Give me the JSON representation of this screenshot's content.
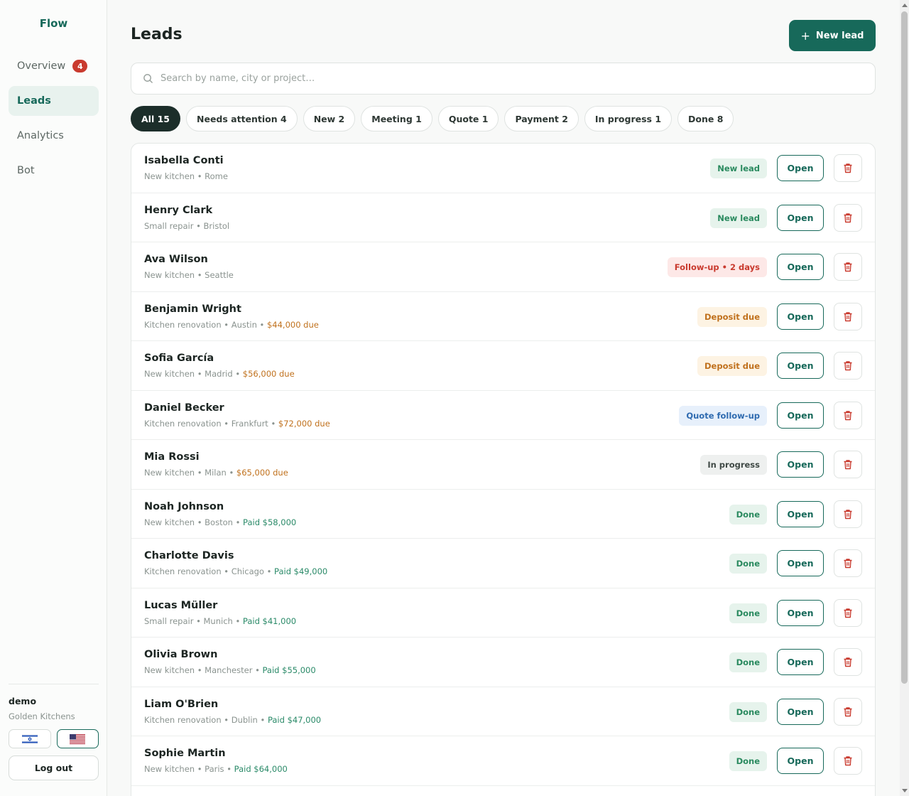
{
  "sidebar": {
    "brand": "Flow",
    "items": [
      {
        "label": "Overview",
        "badge": "4",
        "active": false
      },
      {
        "label": "Leads",
        "active": true
      },
      {
        "label": "Analytics",
        "active": false
      },
      {
        "label": "Bot",
        "active": false
      }
    ],
    "user": {
      "name": "demo",
      "org": "Golden Kitchens"
    },
    "languages": [
      {
        "flag": "israel-flag-icon",
        "active": false
      },
      {
        "flag": "us-flag-icon",
        "active": true
      }
    ],
    "logout_label": "Log out"
  },
  "header": {
    "title": "Leads",
    "new_lead_label": "New lead",
    "search_placeholder": "Search by name, city or project…"
  },
  "filters": [
    {
      "label": "All 15",
      "active": true
    },
    {
      "label": "Needs attention 4"
    },
    {
      "label": "New 2"
    },
    {
      "label": "Meeting 1"
    },
    {
      "label": "Quote 1"
    },
    {
      "label": "Payment 2"
    },
    {
      "label": "In progress 1"
    },
    {
      "label": "Done 8"
    }
  ],
  "open_label": "Open",
  "leads": [
    {
      "name": "Isabella Conti",
      "meta": "New kitchen • Rome",
      "amount": "",
      "amount_type": "",
      "status": "New lead",
      "status_type": "new"
    },
    {
      "name": "Henry Clark",
      "meta": "Small repair • Bristol",
      "amount": "",
      "amount_type": "",
      "status": "New lead",
      "status_type": "new"
    },
    {
      "name": "Ava Wilson",
      "meta": "New kitchen • Seattle",
      "amount": "",
      "amount_type": "",
      "status": "Follow-up • 2 days",
      "status_type": "follow"
    },
    {
      "name": "Benjamin Wright",
      "meta": "Kitchen renovation • Austin • ",
      "amount": "$44,000 due",
      "amount_type": "due",
      "status": "Deposit due",
      "status_type": "deposit"
    },
    {
      "name": "Sofia García",
      "meta": "New kitchen • Madrid • ",
      "amount": "$56,000 due",
      "amount_type": "due",
      "status": "Deposit due",
      "status_type": "deposit"
    },
    {
      "name": "Daniel Becker",
      "meta": "Kitchen renovation • Frankfurt • ",
      "amount": "$72,000 due",
      "amount_type": "due",
      "status": "Quote follow-up",
      "status_type": "quote"
    },
    {
      "name": "Mia Rossi",
      "meta": "New kitchen • Milan • ",
      "amount": "$65,000 due",
      "amount_type": "due",
      "status": "In progress",
      "status_type": "progress"
    },
    {
      "name": "Noah Johnson",
      "meta": "New kitchen • Boston • ",
      "amount": "Paid $58,000",
      "amount_type": "paid",
      "status": "Done",
      "status_type": "done"
    },
    {
      "name": "Charlotte Davis",
      "meta": "Kitchen renovation • Chicago • ",
      "amount": "Paid $49,000",
      "amount_type": "paid",
      "status": "Done",
      "status_type": "done"
    },
    {
      "name": "Lucas Müller",
      "meta": "Small repair • Munich • ",
      "amount": "Paid $41,000",
      "amount_type": "paid",
      "status": "Done",
      "status_type": "done"
    },
    {
      "name": "Olivia Brown",
      "meta": "New kitchen • Manchester • ",
      "amount": "Paid $55,000",
      "amount_type": "paid",
      "status": "Done",
      "status_type": "done"
    },
    {
      "name": "Liam O'Brien",
      "meta": "Kitchen renovation • Dublin • ",
      "amount": "Paid $47,000",
      "amount_type": "paid",
      "status": "Done",
      "status_type": "done"
    },
    {
      "name": "Sophie Martin",
      "meta": "New kitchen • Paris • ",
      "amount": "Paid $64,000",
      "amount_type": "paid",
      "status": "Done",
      "status_type": "done"
    }
  ],
  "colors": {
    "accent": "#17695a",
    "danger": "#c93a2e",
    "warning": "#c0711d",
    "info": "#2f6bb0"
  }
}
